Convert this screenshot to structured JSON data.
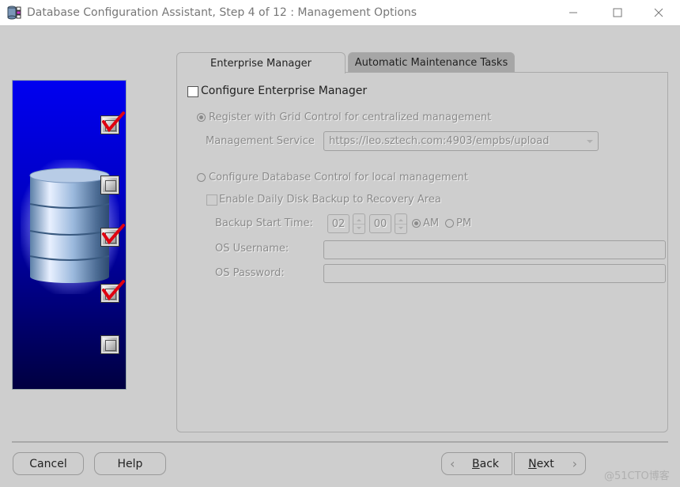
{
  "window": {
    "title": "Database Configuration Assistant, Step 4 of 12 : Management Options",
    "app_icon": "dbca-database-icon",
    "controls": {
      "minimize": "minimize-icon",
      "maximize": "maximize-icon",
      "close": "close-icon"
    }
  },
  "side_panel": {
    "image": "database-cylinder-icon",
    "steps": [
      {
        "state": "checked"
      },
      {
        "state": "unchecked"
      },
      {
        "state": "checked"
      },
      {
        "state": "checked"
      },
      {
        "state": "unchecked"
      }
    ]
  },
  "tabs": [
    {
      "label": "Enterprise Manager",
      "active": true
    },
    {
      "label": "Automatic Maintenance Tasks",
      "active": false
    }
  ],
  "em": {
    "configure_em": {
      "label": "Configure Enterprise Manager",
      "checked": false
    },
    "grid_control": {
      "label": "Register with Grid Control for centralized management",
      "selected": true,
      "enabled": false
    },
    "management_service": {
      "label": "Management Service",
      "value": "https://leo.sztech.com:4903/empbs/upload"
    },
    "db_control": {
      "label": "Configure Database Control for local management",
      "selected": false,
      "enabled": false
    },
    "daily_backup": {
      "label": "Enable Daily Disk Backup to Recovery Area",
      "checked": false
    },
    "backup_time": {
      "label": "Backup Start Time:",
      "hour": "02",
      "minute": "00",
      "am_label": "AM",
      "pm_label": "PM",
      "selected": "AM"
    },
    "os_username": {
      "label": "OS Username:",
      "value": ""
    },
    "os_password": {
      "label": "OS Password:",
      "value": ""
    }
  },
  "buttons": {
    "cancel": "Cancel",
    "help": "Help",
    "back_mnemonic": "B",
    "back_rest": "ack",
    "next_mnemonic": "N",
    "next_rest": "ext"
  },
  "watermark": "@51CTO博客"
}
